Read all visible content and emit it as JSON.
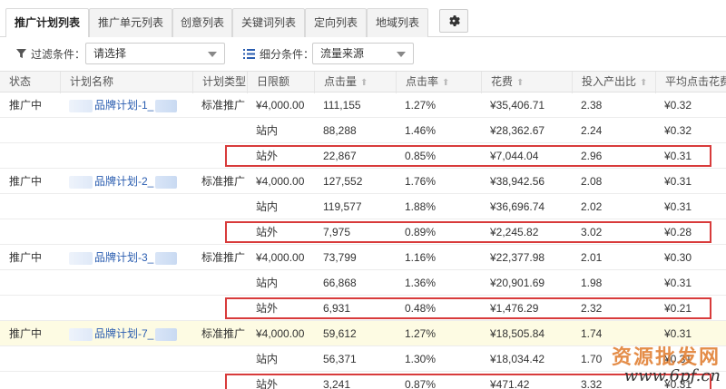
{
  "tabs": [
    {
      "label": "推广计划列表",
      "active": true
    },
    {
      "label": "推广单元列表",
      "active": false
    },
    {
      "label": "创意列表",
      "active": false
    },
    {
      "label": "关键词列表",
      "active": false
    },
    {
      "label": "定向列表",
      "active": false
    },
    {
      "label": "地域列表",
      "active": false
    }
  ],
  "settings_icon": "gear-icon",
  "filter": {
    "filter_label": "过滤条件：",
    "filter_value": "请选择",
    "segment_label": "细分条件：",
    "segment_value": "流量来源"
  },
  "columns": [
    "状态",
    "计划名称",
    "计划类型",
    "日限额",
    "点击量",
    "点击率",
    "花费",
    "投入产出比",
    "平均点击花费"
  ],
  "rows": [
    {
      "status": "推广中",
      "name_pre": "品牌计划-1_",
      "type": "标准推广",
      "budget": "¥4,000.00",
      "clicks": "111,155",
      "ctr": "1.27%",
      "cost": "¥35,406.71",
      "roi": "2.38",
      "cpc": "¥0.32"
    },
    {
      "source": "站内",
      "clicks": "88,288",
      "ctr": "1.46%",
      "cost": "¥28,362.67",
      "roi": "2.24",
      "cpc": "¥0.32"
    },
    {
      "source": "站外",
      "clicks": "22,867",
      "ctr": "0.85%",
      "cost": "¥7,044.04",
      "roi": "2.96",
      "cpc": "¥0.31"
    },
    {
      "status": "推广中",
      "name_pre": "品牌计划-2_",
      "type": "标准推广",
      "budget": "¥4,000.00",
      "clicks": "127,552",
      "ctr": "1.76%",
      "cost": "¥38,942.56",
      "roi": "2.08",
      "cpc": "¥0.31"
    },
    {
      "source": "站内",
      "clicks": "119,577",
      "ctr": "1.88%",
      "cost": "¥36,696.74",
      "roi": "2.02",
      "cpc": "¥0.31"
    },
    {
      "source": "站外",
      "clicks": "7,975",
      "ctr": "0.89%",
      "cost": "¥2,245.82",
      "roi": "3.02",
      "cpc": "¥0.28"
    },
    {
      "status": "推广中",
      "name_pre": "品牌计划-3_",
      "type": "标准推广",
      "budget": "¥4,000.00",
      "clicks": "73,799",
      "ctr": "1.16%",
      "cost": "¥22,377.98",
      "roi": "2.01",
      "cpc": "¥0.30"
    },
    {
      "source": "站内",
      "clicks": "66,868",
      "ctr": "1.36%",
      "cost": "¥20,901.69",
      "roi": "1.98",
      "cpc": "¥0.31"
    },
    {
      "source": "站外",
      "clicks": "6,931",
      "ctr": "0.48%",
      "cost": "¥1,476.29",
      "roi": "2.32",
      "cpc": "¥0.21"
    },
    {
      "status": "推广中",
      "name_pre": "品牌计划-7_",
      "type": "标准推广",
      "budget": "¥4,000.00",
      "clicks": "59,612",
      "ctr": "1.27%",
      "cost": "¥18,505.84",
      "roi": "1.74",
      "cpc": "¥0.31"
    },
    {
      "source": "站内",
      "clicks": "56,371",
      "ctr": "1.30%",
      "cost": "¥18,034.42",
      "roi": "1.70",
      "cpc": "¥0.31"
    },
    {
      "source": "站外",
      "clicks": "3,241",
      "ctr": "0.87%",
      "cost": "¥471.42",
      "roi": "3.32",
      "cpc": "¥0.31"
    }
  ],
  "watermark": {
    "line1": "资源批发网",
    "line2": "www.6pf.cn"
  },
  "colors": {
    "highlight_box": "#d83b3b",
    "link": "#2a5db0",
    "row_highlight": "#fdfbe3"
  }
}
